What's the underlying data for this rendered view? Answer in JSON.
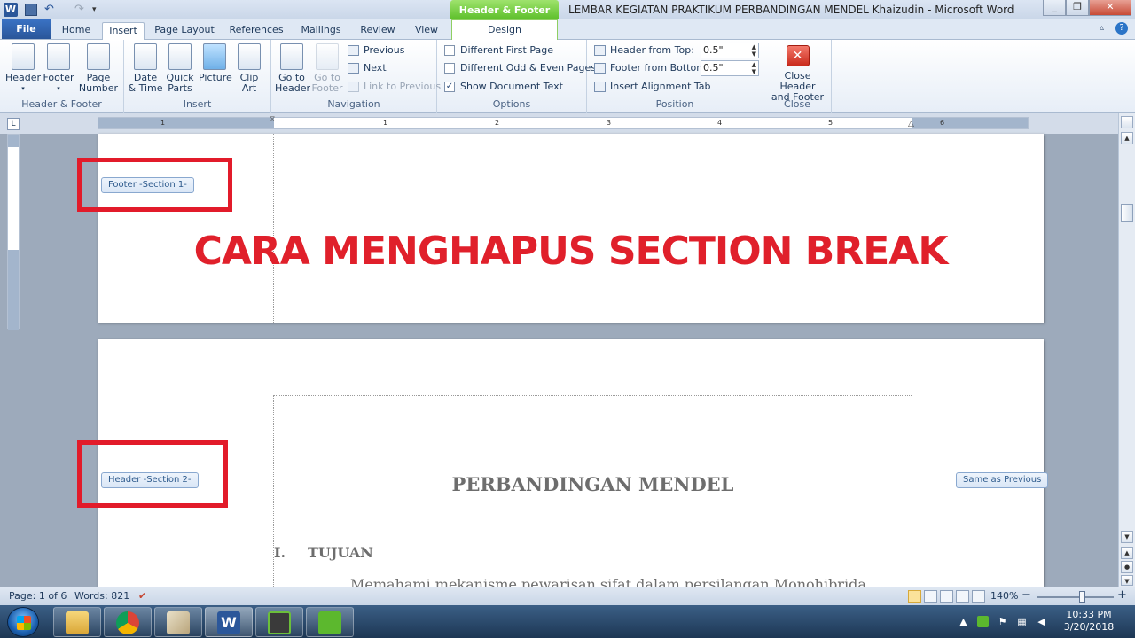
{
  "window": {
    "title": "LEMBAR KEGIATAN PRAKTIKUM PERBANDINGAN MENDEL Khaizudin  -  Microsoft Word",
    "contextual_tools": "Header & Footer Tools",
    "app_icon_letter": "W"
  },
  "tabs": [
    "File",
    "Home",
    "Insert",
    "Page Layout",
    "References",
    "Mailings",
    "Review",
    "View",
    "Design"
  ],
  "ribbon": {
    "header_footer": {
      "label": "Header & Footer",
      "header": "Header",
      "footer": "Footer",
      "page_number_1": "Page",
      "page_number_2": "Number"
    },
    "insert": {
      "label": "Insert",
      "date_time_1": "Date",
      "date_time_2": "& Time",
      "quick_parts_1": "Quick",
      "quick_parts_2": "Parts",
      "picture": "Picture",
      "clip_art_1": "Clip",
      "clip_art_2": "Art"
    },
    "navigation": {
      "label": "Navigation",
      "goto_header_1": "Go to",
      "goto_header_2": "Header",
      "goto_footer_1": "Go to",
      "goto_footer_2": "Footer",
      "previous": "Previous",
      "next": "Next",
      "link_previous": "Link to Previous"
    },
    "options": {
      "label": "Options",
      "different_first": "Different First Page",
      "different_odd_even": "Different Odd & Even Pages",
      "show_doc_text": "Show Document Text",
      "show_doc_text_checked": "✓"
    },
    "position": {
      "label": "Position",
      "header_from_top": "Header from Top:",
      "header_from_top_value": "0.5\"",
      "footer_from_bottom": "Footer from Bottom:",
      "footer_from_bottom_value": "0.5\"",
      "insert_alignment_tab": "Insert Alignment Tab"
    },
    "close": {
      "label": "Close",
      "close_hf_1": "Close Header",
      "close_hf_2": "and Footer",
      "close_glyph": "✕"
    }
  },
  "ruler": {
    "corner_glyph": "L",
    "numbers": [
      "1",
      "1",
      "2",
      "3",
      "4",
      "5",
      "6"
    ]
  },
  "document": {
    "footer_tag": "Footer -Section 1-",
    "header_tag": "Header -Section 2-",
    "same_as_previous": "Same as Previous",
    "overlay_title": "CARA MENGHAPUS SECTION BREAK",
    "heading": "PERBANDINGAN MENDEL",
    "section_number": "I.",
    "section_title": "TUJUAN",
    "body_text": "Memahami mekanisme pewarisan sifat dalam persilangan Monohibrida"
  },
  "statusbar": {
    "page": "Page: 1 of 6",
    "words": "Words: 821",
    "zoom": "140%",
    "zoom_minus": "−",
    "zoom_plus": "+",
    "zoom_level_pct": 58
  },
  "taskbar": {
    "time": "10:33 PM",
    "date": "3/20/2018"
  }
}
